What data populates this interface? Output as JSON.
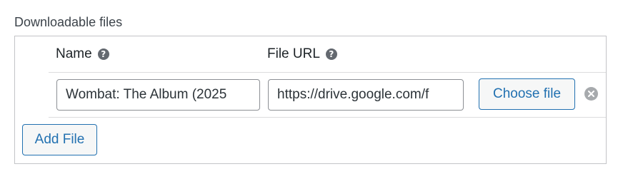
{
  "section": {
    "title": "Downloadable files"
  },
  "table": {
    "columns": [
      {
        "label": "Name",
        "help_icon": "question-circle-icon"
      },
      {
        "label": "File URL",
        "help_icon": "question-circle-icon"
      }
    ],
    "rows": [
      {
        "name_value": "Wombat: The Album (2025",
        "url_value": "https://drive.google.com/f",
        "choose_label": "Choose file",
        "remove_icon": "remove-circle-icon"
      }
    ]
  },
  "actions": {
    "add_file_label": "Add File"
  },
  "colors": {
    "accent": "#2271b1",
    "border": "#c3c4c7",
    "help_icon_bg": "#646970",
    "remove_icon_bg": "#a7aaad"
  }
}
